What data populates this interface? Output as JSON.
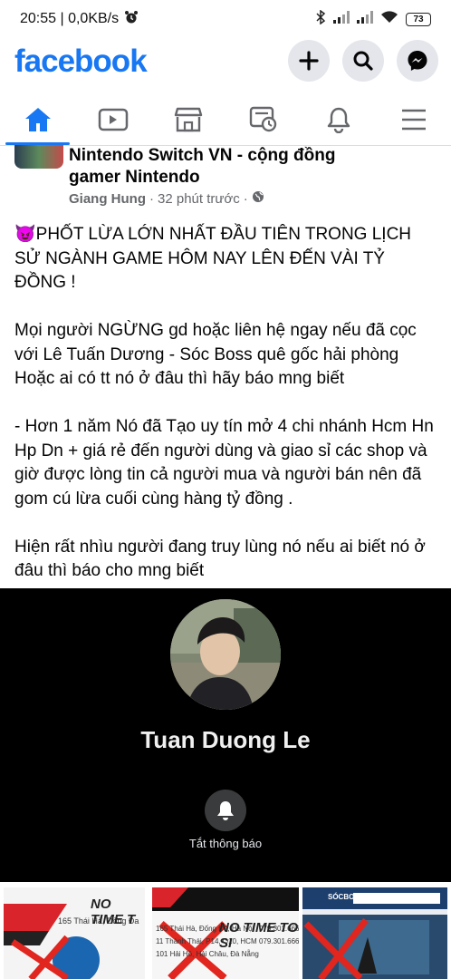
{
  "status": {
    "time_speed": "20:55 | 0,0KB/s",
    "battery": "73"
  },
  "header": {
    "logo": "facebook"
  },
  "post": {
    "group_name": "Nintendo Switch VN - cộng đồng gamer Nintendo",
    "author": "Giang Hung",
    "time": "32 phút trước",
    "body": "😈PHỐT LỪA LỚN NHẤT ĐẦU TIÊN TRONG LỊCH SỬ NGÀNH GAME HÔM NAY LÊN ĐẾN VÀI TỶ ĐỒNG !\n\nMọi người NGỪNG gd hoặc liên hệ ngay nếu đã cọc với Lê Tuấn Dương - Sóc Boss quê gốc hải phòng Hoặc ai có tt nó ở đâu thì hãy báo mng biết\n\n- Hơn 1 năm Nó đã Tạo uy tín mở 4 chi nhánh Hcm Hn Hp Dn + giá rẻ đến người dùng và giao sỉ các shop và giờ được lòng tin cả người mua và người bán nên đã gom cú lừa cuối cùng hàng tỷ đồng .\n\nHiện rất nhìu người đang truy lùng nó nếu ai biết nó ở đâu thì báo cho mng biết"
  },
  "profile_card": {
    "name": "Tuan Duong Le",
    "notify_label": "Tắt thông báo"
  },
  "thumbnails": [
    {
      "title": "NO TIME T"
    },
    {
      "title": "NO TIME TO SI"
    },
    {
      "title": "SÓCBOSS"
    }
  ],
  "colors": {
    "brand": "#1877f2",
    "icon_gray": "#65676b",
    "cross_red": "#e0261f"
  }
}
